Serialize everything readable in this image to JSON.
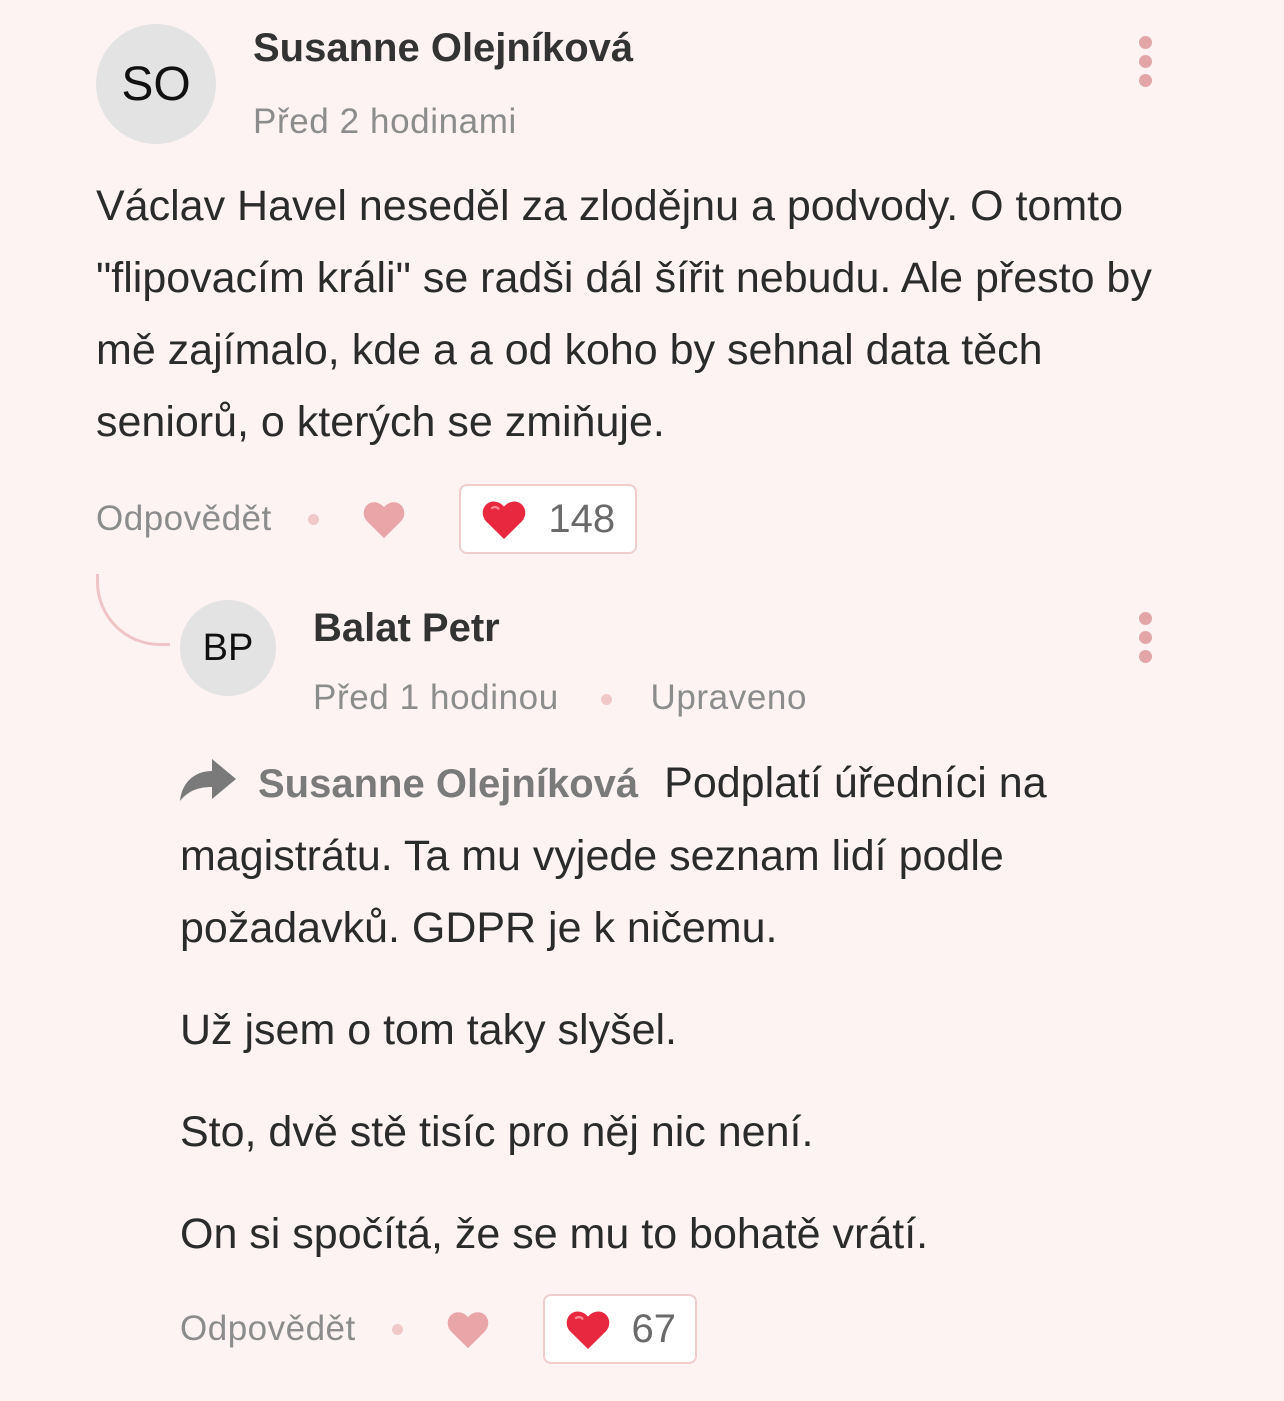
{
  "comment": {
    "avatar_initials": "SO",
    "author": "Susanne Olejníková",
    "time": "Před 2 hodinami",
    "text": "Václav Havel neseděl za zlodějnu a podvody. O tomto \"flipovacím králi\" se radši dál šířit nebudu. Ale přesto by mě zajímalo, kde a a od koho by sehnal data těch seniorů, o kterých se zmiňuje.",
    "reply_label": "Odpovědět",
    "like_count": "148"
  },
  "reply": {
    "avatar_initials": "BP",
    "author": "Balat Petr",
    "time": "Před 1 hodinou",
    "edited_label": "Upraveno",
    "quoted_author": "Susanne Olejníková",
    "paragraphs": [
      "Podplatí úředníci na magistrátu. Ta mu vyjede seznam lidí podle požadavků. GDPR je k ničemu.",
      "Už jsem o tom taky slyšel.",
      "Sto, dvě stě tisíc pro něj nic není.",
      "On si spočítá, že se mu to bohatě vrátí."
    ],
    "reply_label": "Odpovědět",
    "like_count": "67"
  },
  "colors": {
    "background": "#fdf3f3",
    "accent_pink": "#e2a6a8",
    "heart_red": "#e8283e",
    "heart_outline": "#eaa5a9",
    "muted_text": "#8c8c8c"
  },
  "icons": [
    "more-vertical-icon",
    "heart-outline-icon",
    "heart-filled-icon",
    "reply-arrow-icon"
  ]
}
